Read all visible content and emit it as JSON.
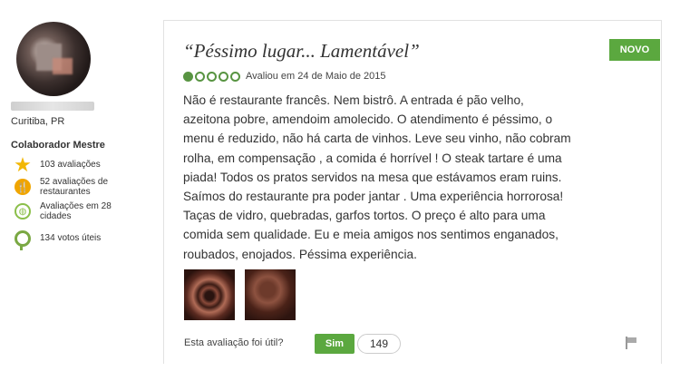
{
  "reviewer": {
    "location": "Curitiba, PR",
    "level": "Colaborador Mestre",
    "badges": [
      {
        "icon": "star-icon",
        "text": "103 avaliações"
      },
      {
        "icon": "restaurant-icon",
        "text": "52 avaliações de restaurantes"
      },
      {
        "icon": "globe-icon",
        "text": "Avaliações em 28 cidades"
      },
      {
        "icon": "helpful-votes-icon",
        "text": "134 votos úteis"
      }
    ]
  },
  "review": {
    "badge": "NOVO",
    "title": "“Péssimo lugar... Lamentável”",
    "rating": 1,
    "rating_max": 5,
    "date": "Avaliou em 24 de Maio de 2015",
    "lines": [
      "Não é restaurante francês. Nem bistrô. A entrada é pão velho,",
      "azeitona pobre, amendoim amolecido. O atendimento é péssimo, o",
      "menu é reduzido, não há carta de vinhos. Leve seu vinho, não cobram",
      "rolha, em compensação , a comida é horrível ! O steak tartare é uma",
      "piada! Todos os pratos servidos na mesa que estávamos eram ruins.",
      "Saímos do restaurante pra poder jantar . Uma experiência horrorosa!",
      "Taças de vidro, quebradas, garfos tortos. O preço é alto para uma",
      "comida sem qualidade. Eu e meia amigos nos sentimos enganados,",
      "roubados, enojados. Péssima experiência."
    ],
    "helpful_question": "Esta avaliação foi útil?",
    "helpful_button": "Sim",
    "helpful_count": "149"
  },
  "colors": {
    "accent": "#5ba83f",
    "bubble": "#589442"
  }
}
